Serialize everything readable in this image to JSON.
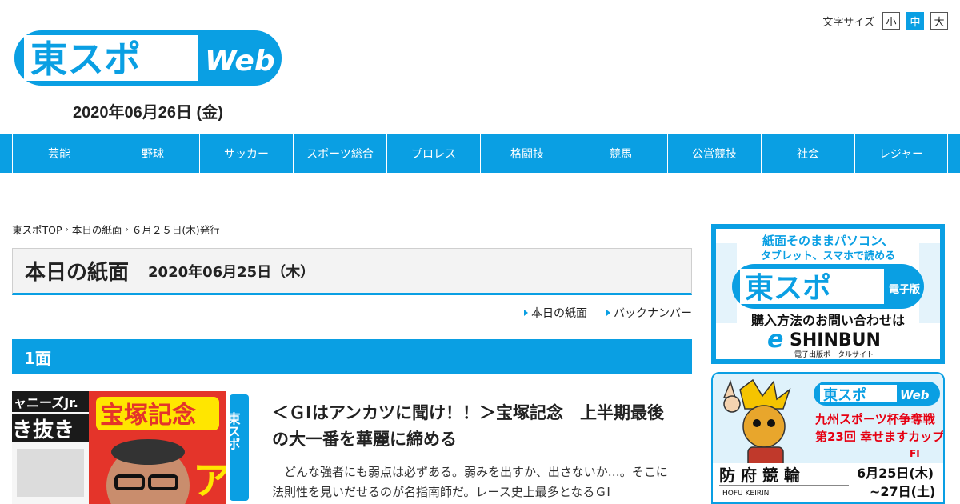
{
  "header": {
    "logo_text": "東スポ",
    "logo_web": "Web",
    "date": "2020年06月26日 (金)",
    "font_size_label": "文字サイズ",
    "font_sizes": [
      "小",
      "中",
      "大"
    ]
  },
  "nav": {
    "items": [
      "芸能",
      "野球",
      "サッカー",
      "スポーツ総合",
      "プロレス",
      "格闘技",
      "競馬",
      "公営競技",
      "社会",
      "レジャー"
    ]
  },
  "breadcrumb": [
    "東スポTOP",
    "本日の紙面",
    "６月２５日(木)発行"
  ],
  "page": {
    "title": "本日の紙面",
    "date": "2020年06月25日（木）",
    "links": [
      "本日の紙面",
      "バックナンバー"
    ]
  },
  "section": {
    "label": "1面"
  },
  "thumbnail": {
    "left_text_1": "ャニーズJr.",
    "left_text_2": "き抜き",
    "headline": "宝塚記念",
    "big_text": "アン",
    "side_text": "東スポ"
  },
  "article": {
    "title": "＜ＧⅠはアンカツに聞け！！＞宝塚記念　上半期最後の大一番を華麗に締める",
    "body": "どんな強者にも弱点は必ずある。弱みを出すか、出さないか…。そこに法則性を見いだせるのが名指南師だ。レース史上最多となるＧⅠ"
  },
  "banner1": {
    "line1": "紙面そのままパソコン、",
    "line2": "タブレット、スマホで読める",
    "logo": "東スポ",
    "logo_sub": "電子版",
    "line3": "購入方法のお問い合わせは",
    "brand": "SHINBUN",
    "brand_e": "e",
    "brand_sub": "電子出版ポータルサイト"
  },
  "banner2": {
    "logo": "東スポ",
    "logo_web": "Web",
    "event1": "九州スポーツ杯争奪戦",
    "event2": "第23回 幸せますカップ",
    "grade": "FⅠ",
    "venue": "防 府 競 輪",
    "venue_roman": "HOFU KEIRIN",
    "date1": "6月25日(木)",
    "date2": "~27日(土)"
  },
  "colors": {
    "brand_blue": "#0a9fe3",
    "banner_yellow": "#ffe600",
    "banner_red": "#e60012"
  }
}
